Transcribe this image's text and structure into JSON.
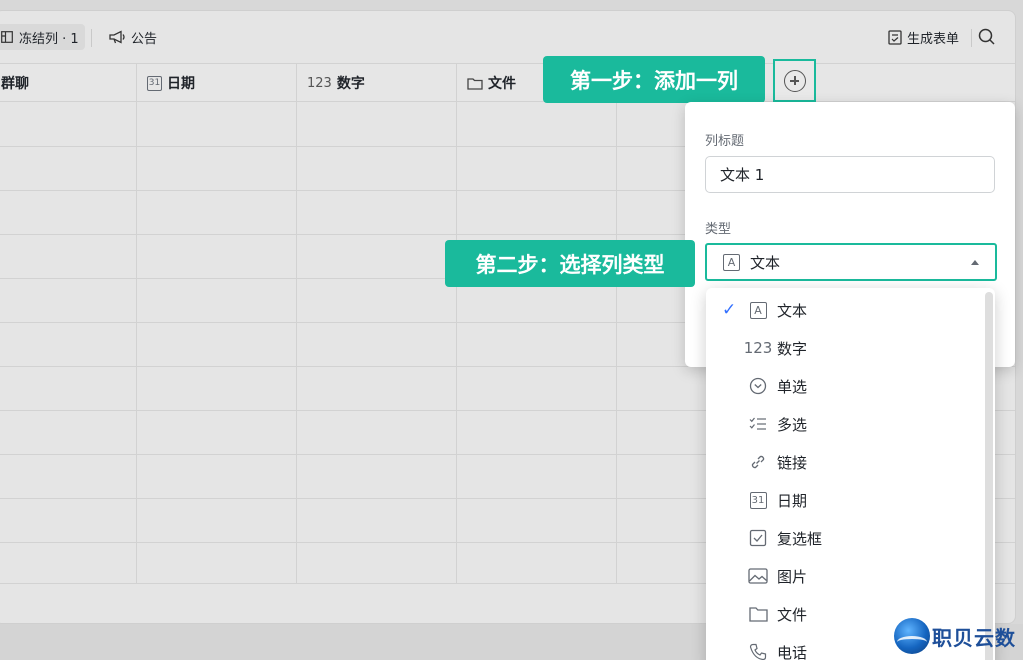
{
  "toolbar": {
    "freeze_label": "冻结列 · 1",
    "notice_label": "公告",
    "form_label": "生成表单"
  },
  "columns": [
    {
      "icon": "",
      "label": "群聊"
    },
    {
      "icon": "31",
      "label": "日期"
    },
    {
      "icon": "123",
      "label": "数字"
    },
    {
      "icon": "folder",
      "label": "文件"
    }
  ],
  "callouts": {
    "step1": "第一步：添加一列",
    "step2": "第二步：选择列类型"
  },
  "panel": {
    "title_label": "列标题",
    "title_value": "文本 1",
    "type_label": "类型",
    "type_value": "文本",
    "type_icon": "A"
  },
  "type_options": [
    {
      "icon": "A",
      "label": "文本",
      "selected": true
    },
    {
      "icon": "123",
      "label": "数字",
      "selected": false
    },
    {
      "icon": "chevron-circle",
      "label": "单选",
      "selected": false
    },
    {
      "icon": "checklist",
      "label": "多选",
      "selected": false
    },
    {
      "icon": "link",
      "label": "链接",
      "selected": false
    },
    {
      "icon": "31",
      "label": "日期",
      "selected": false
    },
    {
      "icon": "checkbox",
      "label": "复选框",
      "selected": false
    },
    {
      "icon": "image",
      "label": "图片",
      "selected": false
    },
    {
      "icon": "folder",
      "label": "文件",
      "selected": false
    },
    {
      "icon": "phone",
      "label": "电话",
      "selected": false
    }
  ],
  "logo": {
    "text": "职贝云数"
  },
  "colors": {
    "accent": "#1aba9c",
    "check": "#3370ff"
  }
}
